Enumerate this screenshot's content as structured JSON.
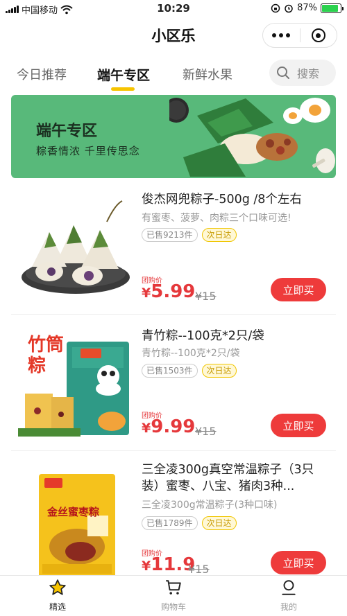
{
  "status_bar": {
    "carrier": "中国移动",
    "time": "10:29",
    "battery": "87%",
    "battery_level": 0.87
  },
  "app": {
    "title": "小区乐"
  },
  "tabs": [
    {
      "label": "今日推荐",
      "active": false
    },
    {
      "label": "端午专区",
      "active": true
    },
    {
      "label": "新鲜水果",
      "active": false
    }
  ],
  "search": {
    "label": "搜索"
  },
  "banner": {
    "title": "端午专区",
    "subtitle": "粽香情浓 千里传思念"
  },
  "products": [
    {
      "name": "俊杰网兜粽子-500g /8个左右",
      "desc": "有蜜枣、菠萝、肉粽三个口味可选!",
      "sold": "已售9213件",
      "delivery": "次日达",
      "price_label": "团购价",
      "price_symbol": "¥",
      "price": "5.99",
      "old_price": "¥15",
      "buy_label": "立即买"
    },
    {
      "name": "青竹粽--100克*2只/袋",
      "desc": "青竹粽--100克*2只/袋",
      "sold": "已售1503件",
      "delivery": "次日达",
      "price_label": "团购价",
      "price_symbol": "¥",
      "price": "9.99",
      "old_price": "¥15",
      "buy_label": "立即买",
      "image_text": "竹筒粽"
    },
    {
      "name": "三全凌300g真空常温粽子（3只装）蜜枣、八宝、猪肉3种...",
      "desc": "三全凌300g常温粽子(3种口味)",
      "sold": "已售1789件",
      "delivery": "次日达",
      "price_label": "团购价",
      "price_symbol": "¥",
      "price": "11.9",
      "old_price": "¥15",
      "buy_label": "立即买",
      "image_text": "金丝蜜枣粽"
    }
  ],
  "bottom_nav": [
    {
      "label": "精选",
      "icon": "star-icon",
      "active": true
    },
    {
      "label": "购物车",
      "icon": "cart-icon",
      "active": false
    },
    {
      "label": "我的",
      "icon": "profile-icon",
      "active": false
    }
  ],
  "colors": {
    "accent": "#f7c400",
    "price": "#e5383b",
    "buy_button": "#ee3b3b",
    "banner": "#58b97a"
  }
}
